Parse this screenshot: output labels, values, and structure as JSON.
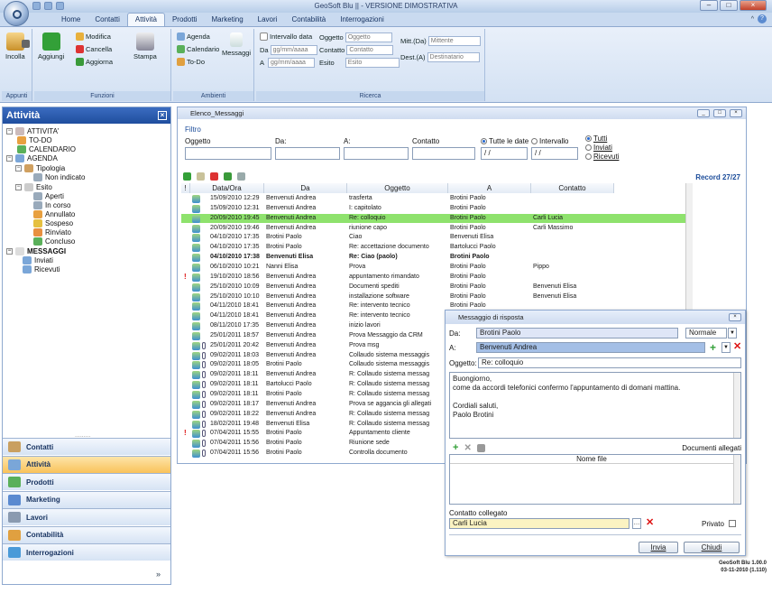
{
  "window": {
    "title": "GeoSoft Blu || - VERSIONE DIMOSTRATIVA",
    "controls": [
      "–",
      "□",
      "×"
    ]
  },
  "tabs": [
    "Home",
    "Contatti",
    "Attività",
    "Prodotti",
    "Marketing",
    "Lavori",
    "Contabilità",
    "Interrogazioni"
  ],
  "active_tab": "Attività",
  "ribbon": {
    "appunti": {
      "label": "Appunti",
      "incolla": "Incolla"
    },
    "funzioni": {
      "label": "Funzioni",
      "aggiungi": "Aggiungi",
      "modifica": "Modifica",
      "cancella": "Cancella",
      "aggiorna": "Aggiorna",
      "stampa": "Stampa"
    },
    "ambienti": {
      "label": "Ambienti",
      "agenda": "Agenda",
      "calendario": "Calendario",
      "todo": "To-Do",
      "messaggi": "Messaggi"
    },
    "ricerca": {
      "label": "Ricerca",
      "intervallo_data": "Intervallo data",
      "da": "Da",
      "a": "A",
      "date_placeholder": "gg/mm/aaaa",
      "oggetto_label": "Oggetto",
      "oggetto_ph": "Oggetto",
      "contatto_label": "Contatto",
      "contatto_ph": "Contatto",
      "esito_label": "Esito",
      "esito_ph": "Esito",
      "mitt_label": "Mitt.(Da)",
      "mitt_ph": "Mittente",
      "dest_label": "Dest.(A)",
      "dest_ph": "Destinatario"
    }
  },
  "left_panel": {
    "title": "Attività",
    "tree": [
      "ATTIVITA'",
      "TO-DO",
      "CALENDARIO",
      "AGENDA",
      "Tipologia",
      "Non indicato",
      "Esito",
      "Aperti",
      "In corso",
      "Annullato",
      "Sospeso",
      "Rinviato",
      "Concluso",
      "MESSAGGI",
      "Inviati",
      "Ricevuti"
    ],
    "nav": [
      "Contatti",
      "Attività",
      "Prodotti",
      "Marketing",
      "Lavori",
      "Contabilità",
      "Interrogazioni"
    ]
  },
  "messages_window": {
    "title": "Elenco_Messaggi",
    "filter_label": "Filtro",
    "oggetto": "Oggetto",
    "da": "Da:",
    "a": "A:",
    "contatto": "Contatto",
    "radio_dates": [
      "Tutte le date",
      "Intervallo"
    ],
    "date_placeholder": "/ /",
    "radio_type": [
      "Tutti",
      "Inviati",
      "Ricevuti"
    ],
    "record": "Record 27/27",
    "columns": [
      "!",
      "Data/Ora",
      "Da",
      "Oggetto",
      "A",
      "Contatto"
    ],
    "rows": [
      [
        "",
        "15/09/2010 12:29",
        "Benvenuti Andrea",
        "trasferta",
        "Brotini Paolo",
        ""
      ],
      [
        "",
        "15/09/2010 12:31",
        "Benvenuti Andrea",
        "I: capitolato",
        "Brotini Paolo",
        ""
      ],
      [
        "",
        "20/09/2010 19:45",
        "Benvenuti Andrea",
        "Re: colloquio",
        "Brotini Paolo",
        "Carli Lucia"
      ],
      [
        "",
        "20/09/2010 19:46",
        "Benvenuti Andrea",
        "riunione capo",
        "Brotini Paolo",
        "Carli Massimo"
      ],
      [
        "",
        "04/10/2010 17:35",
        "Brotini Paolo",
        "Ciao",
        "Benvenuti Elisa",
        ""
      ],
      [
        "",
        "04/10/2010 17:35",
        "Brotini Paolo",
        "Re: accettazione documento",
        "Bartolucci Paolo",
        ""
      ],
      [
        "",
        "04/10/2010 17:38",
        "Benvenuti Elisa",
        "Re: Ciao (paolo)",
        "Brotini Paolo",
        ""
      ],
      [
        "",
        "06/10/2010 10:21",
        "Nanni Elisa",
        "Prova",
        "Brotini Paolo",
        "Pippo"
      ],
      [
        "!",
        "19/10/2010 18:56",
        "Benvenuti Andrea",
        "appuntamento rimandato",
        "Brotini Paolo",
        ""
      ],
      [
        "",
        "25/10/2010 10:09",
        "Benvenuti Andrea",
        "Documenti spediti",
        "Brotini Paolo",
        "Benvenuti Elisa"
      ],
      [
        "",
        "25/10/2010 10:10",
        "Benvenuti Andrea",
        "installazione software",
        "Brotini Paolo",
        "Benvenuti Elisa"
      ],
      [
        "",
        "04/11/2010 18:41",
        "Benvenuti Andrea",
        "Re: intervento tecnico",
        "Brotini Paolo",
        ""
      ],
      [
        "",
        "04/11/2010 18:41",
        "Benvenuti Andrea",
        "Re: intervento tecnico",
        "Brotini Paolo",
        ""
      ],
      [
        "",
        "08/11/2010 17:35",
        "Benvenuti Andrea",
        "inizio lavori",
        "",
        ""
      ],
      [
        "",
        "25/01/2011 18:57",
        "Benvenuti Andrea",
        "Prova Messaggio da CRM",
        "",
        ""
      ],
      [
        "",
        "25/01/2011 20:42",
        "Benvenuti Andrea",
        "Prova msg",
        "",
        ""
      ],
      [
        "",
        "09/02/2011 18:03",
        "Benvenuti Andrea",
        "Collaudo sistema messaggis",
        "",
        ""
      ],
      [
        "",
        "09/02/2011 18:05",
        "Brotini Paolo",
        "Collaudo sistema messaggis",
        "",
        ""
      ],
      [
        "",
        "09/02/2011 18:11",
        "Benvenuti Andrea",
        "R: Collaudo sistema messag",
        "",
        ""
      ],
      [
        "",
        "09/02/2011 18:11",
        "Bartolucci Paolo",
        "R: Collaudo sistema messag",
        "",
        ""
      ],
      [
        "",
        "09/02/2011 18:11",
        "Brotini Paolo",
        "R: Collaudo sistema messag",
        "",
        ""
      ],
      [
        "",
        "09/02/2011 18:17",
        "Benvenuti Andrea",
        "Prova se aggancia gli allegati",
        "",
        ""
      ],
      [
        "",
        "09/02/2011 18:22",
        "Benvenuti Andrea",
        "R: Collaudo sistema messag",
        "",
        ""
      ],
      [
        "",
        "18/02/2011 19:48",
        "Benvenuti Elisa",
        "R: Collaudo sistema messag",
        "",
        ""
      ],
      [
        "!",
        "07/04/2011 15:55",
        "Brotini Paolo",
        "Appuntamento cliente",
        "",
        ""
      ],
      [
        "",
        "07/04/2011 15:56",
        "Brotini Paolo",
        "Riunione sede",
        "",
        ""
      ],
      [
        "",
        "07/04/2011 15:56",
        "Brotini Paolo",
        "Controlla documento",
        "",
        ""
      ]
    ]
  },
  "reply_dialog": {
    "title": "Messaggio di risposta",
    "da_label": "Da:",
    "da_value": "Brotini Paolo",
    "priority": "Normale",
    "a_label": "A:",
    "a_value": "Benvenuti Andrea",
    "oggetto_label": "Oggetto:",
    "oggetto_value": "Re: colloquio",
    "body": [
      "Buongiorno,",
      "come da accordi telefonici confermo l'appuntamento di domani mattina.",
      "",
      "Cordiali saluti,",
      "Paolo Brotini"
    ],
    "documents_label": "Documenti allegati",
    "file_col": "Nome file",
    "contatto_label": "Contatto collegato",
    "contatto_value": "Carli Lucia",
    "privato": "Privato",
    "invia": "Invia",
    "chiudi": "Chiudi"
  },
  "version": [
    "GeoSoft Blu 1.00.0",
    "03-11-2010 (1.110)"
  ]
}
